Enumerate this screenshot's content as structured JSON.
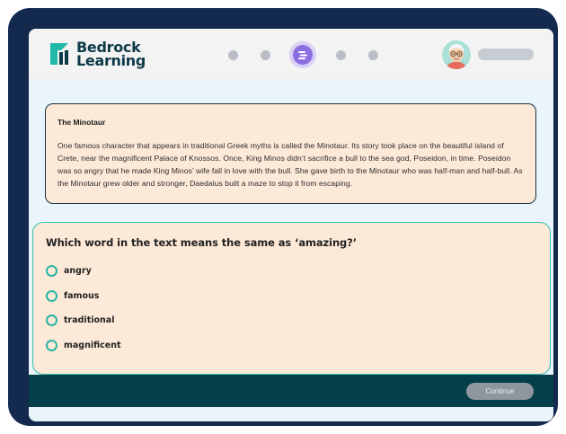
{
  "brand": {
    "line1": "Bedrock",
    "line2": "Learning",
    "text_color": "#0e3a48",
    "mark_colors": [
      "#20b9a9",
      "#0e3a48"
    ]
  },
  "progress": {
    "total_steps": 5,
    "current_step": 3,
    "active_color": "#8b6fe0",
    "inactive_color": "#b9bec6"
  },
  "user": {
    "avatar_icon": "avatar-elderly-person-icon"
  },
  "passage": {
    "title": "The Minotaur",
    "body": "One famous character that appears in traditional Greek myths is called the Minotaur. Its story took place on the beautiful island of Crete, near the magnificent Palace of Knossos. Once, King Minos didn’t sacrifice a bull to the sea god, Poseidon, in time. Poseidon was so angry that he made King Minos’ wife fall in love with the bull. She gave birth to the Minotaur who was half-man and half-bull. As the Minotaur grew older and stronger, Daedalus built a maze to stop it from escaping."
  },
  "question": {
    "prompt": "Which word in the text means the same as ‘amazing?’",
    "options": [
      "angry",
      "famous",
      "traditional",
      "magnificent"
    ]
  },
  "footer": {
    "continue_label": "Continue"
  }
}
